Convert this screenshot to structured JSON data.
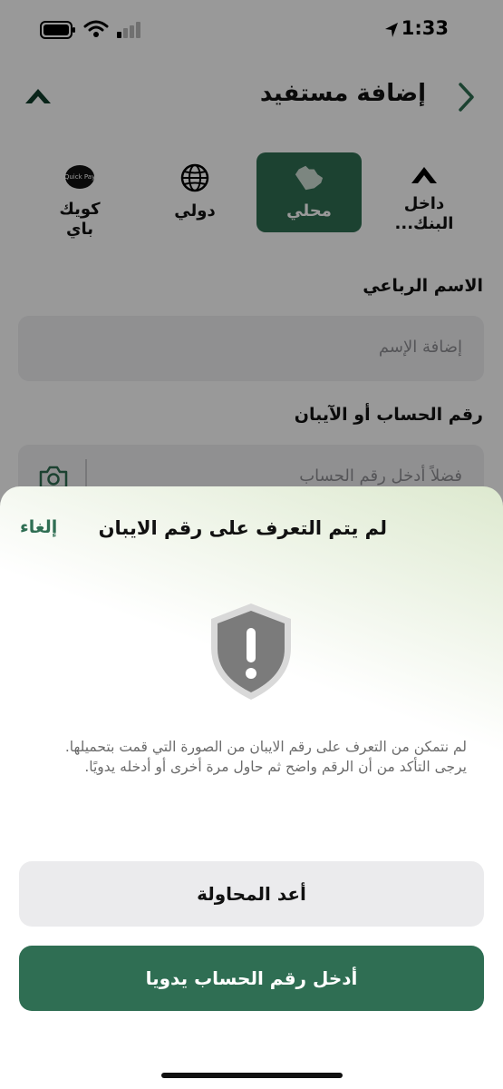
{
  "status_bar": {
    "time": "1:33",
    "icons": [
      "location-arrow-icon",
      "battery-icon",
      "wifi-icon",
      "cellular-signal-icon"
    ]
  },
  "header": {
    "title": "إضافة مستفيد",
    "back_icon": "chevron-right-icon",
    "logo_icon": "bank-logo-icon"
  },
  "beneficiary_types": [
    {
      "label": "داخل البنك...",
      "icon": "bank-logo-icon",
      "selected": false
    },
    {
      "label": "محلي",
      "icon": "saudi-map-icon",
      "selected": true
    },
    {
      "label": "دولي",
      "icon": "globe-icon",
      "selected": false
    },
    {
      "label": "كويك باي",
      "icon": "quick-pay-icon",
      "selected": false
    }
  ],
  "quick_pay_logo_text": "Quick Pay",
  "form": {
    "name_label": "الاسم الرباعي",
    "name_placeholder": "إضافة الإسم",
    "account_label": "رقم الحساب أو الآيبان",
    "account_placeholder": "فضلاً أدخل رقم الحساب"
  },
  "sheet": {
    "title": "لم يتم التعرف على رقم الايبان",
    "cancel": "إلغاء",
    "message": "لم نتمكن من التعرف على رقم الايبان من الصورة التي قمت بتحميلها. يرجى التأكد من أن الرقم واضح ثم حاول مرة أخرى أو أدخله يدويًا.",
    "retry_button": "أعد المحاولة",
    "manual_button": "أدخل رقم الحساب يدويا",
    "alert_icon": "shield-exclamation-icon"
  },
  "colors": {
    "brand_green": "#2f6e53",
    "field_bg": "#f0f0f2",
    "secondary_button_bg": "#ebebed",
    "sheet_gradient_tint": "#dde9cf"
  }
}
